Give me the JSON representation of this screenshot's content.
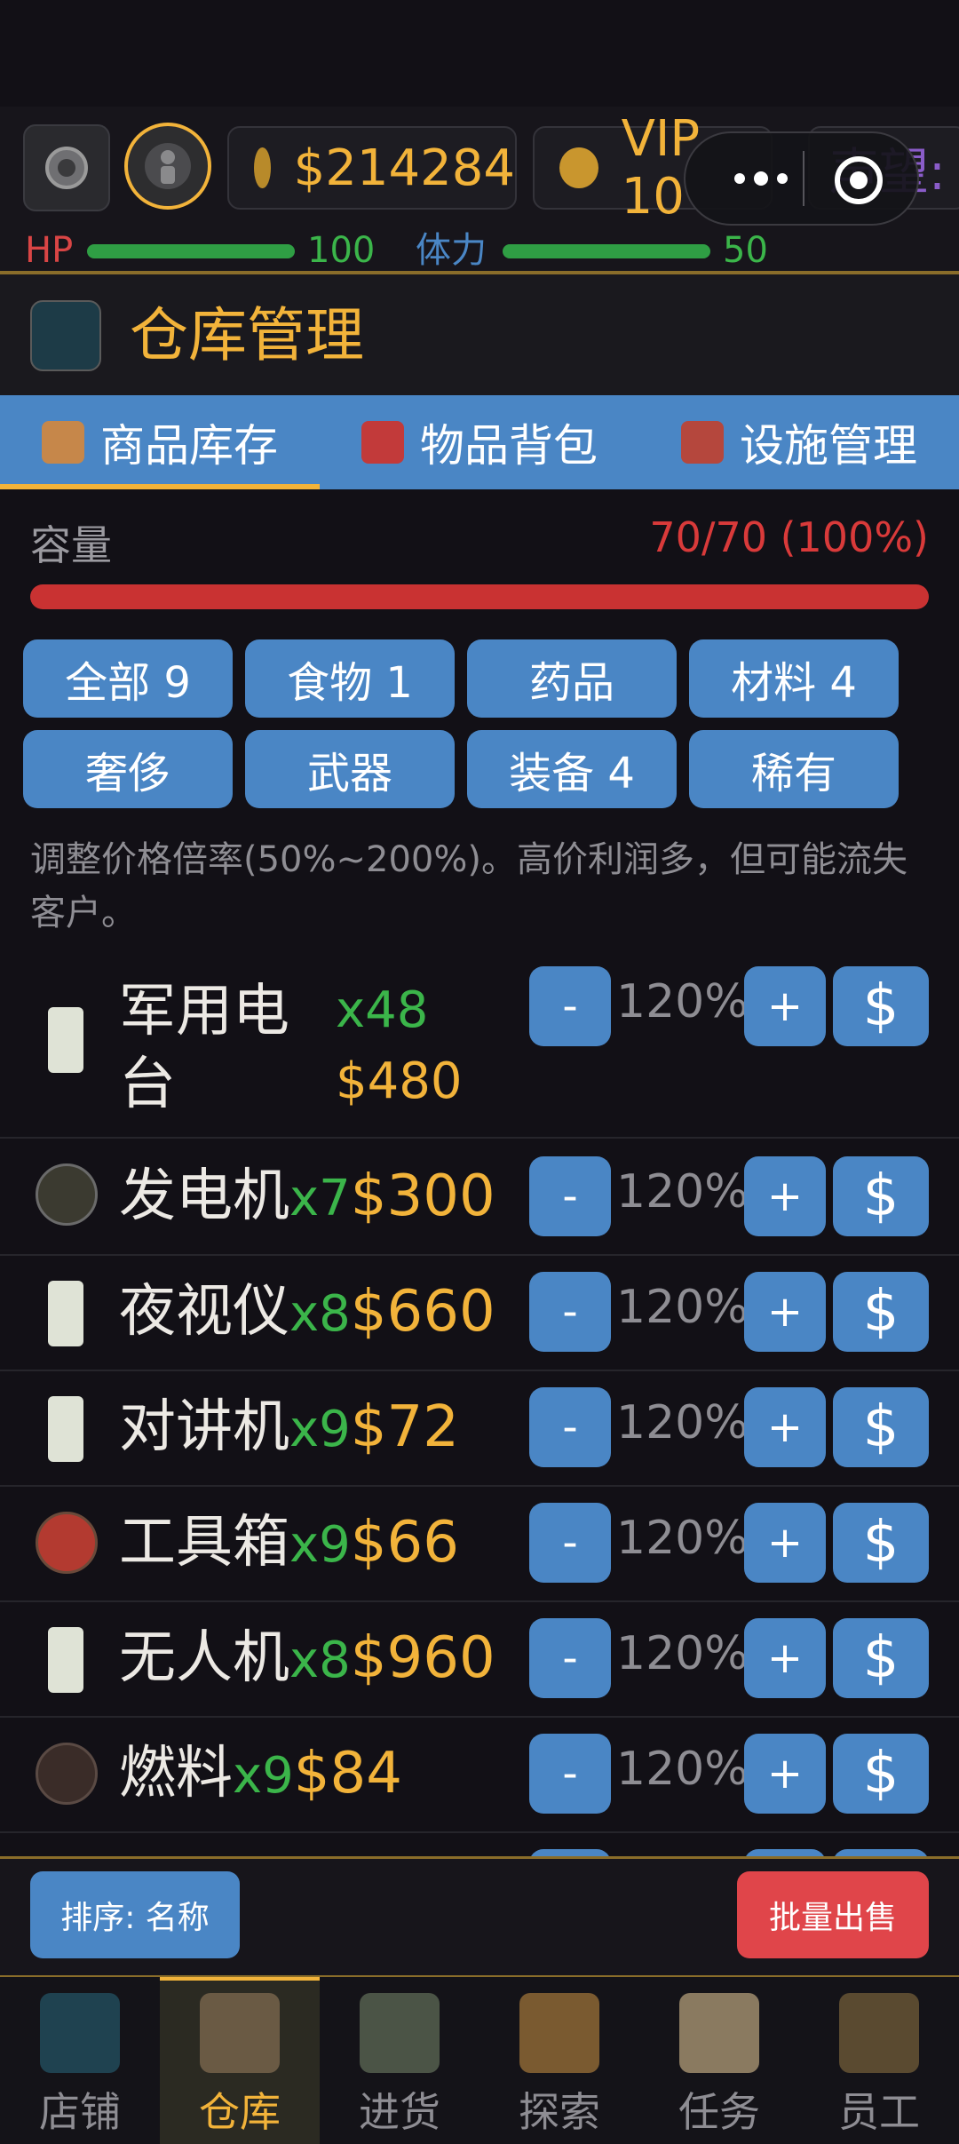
{
  "header": {
    "money": "$214284",
    "vip": "VIP 10",
    "reputation_label": "声望:",
    "hp_label": "HP",
    "hp_value": "100",
    "stamina_label": "体力",
    "stamina_value": "50"
  },
  "page": {
    "title": "仓库管理"
  },
  "tabs": [
    {
      "label": "商品库存",
      "icon": "package-icon"
    },
    {
      "label": "物品背包",
      "icon": "backpack-icon"
    },
    {
      "label": "设施管理",
      "icon": "crane-icon"
    }
  ],
  "capacity": {
    "label": "容量",
    "value": "70/70 (100%)",
    "fill": 1.0
  },
  "filters": [
    "全部 9",
    "食物 1",
    "药品",
    "材料 4",
    "奢侈",
    "武器",
    "装备 4",
    "稀有"
  ],
  "note": "调整价格倍率(50%~200%)。高价利润多，但可能流失客户。",
  "controls": {
    "minus": "-",
    "plus": "+",
    "sell": "$"
  },
  "items": [
    {
      "name": "军用电台",
      "qty": "x48",
      "price": "$480",
      "pct": "120%",
      "icon": "radio-icon"
    },
    {
      "name": "发电机",
      "qty": "x7",
      "price": "$300",
      "pct": "120%",
      "icon": "energy-icon"
    },
    {
      "name": "夜视仪",
      "qty": "x8",
      "price": "$660",
      "pct": "120%",
      "icon": "radio-icon"
    },
    {
      "name": "对讲机",
      "qty": "x9",
      "price": "$72",
      "pct": "120%",
      "icon": "radio-icon"
    },
    {
      "name": "工具箱",
      "qty": "x9",
      "price": "$66",
      "pct": "120%",
      "icon": "toolbox-icon"
    },
    {
      "name": "无人机",
      "qty": "x8",
      "price": "$960",
      "pct": "120%",
      "icon": "radio-icon"
    },
    {
      "name": "燃料",
      "qty": "x9",
      "price": "$84",
      "pct": "120%",
      "icon": "fuel-icon"
    }
  ],
  "actions": {
    "sort": "排序: 名称",
    "batch_sell": "批量出售"
  },
  "nav": [
    {
      "label": "店铺",
      "icon": "shop-icon"
    },
    {
      "label": "仓库",
      "icon": "warehouse-icon",
      "active": true
    },
    {
      "label": "进货",
      "icon": "truck-icon"
    },
    {
      "label": "探索",
      "icon": "map-icon"
    },
    {
      "label": "任务",
      "icon": "checklist-icon"
    },
    {
      "label": "员工",
      "icon": "team-icon"
    }
  ],
  "colors": {
    "accent": "#f2b33a",
    "blue": "#4a86c5",
    "red": "#c93232",
    "green": "#3bb54a"
  }
}
